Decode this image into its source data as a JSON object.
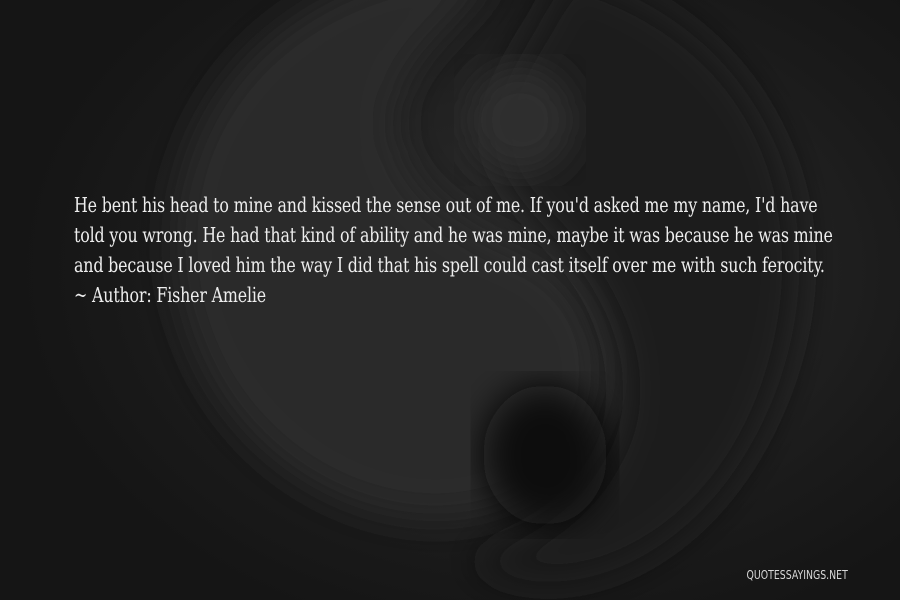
{
  "quote": {
    "text": "He bent his head to mine and kissed the sense out of me. If you'd asked me my name, I'd have told you wrong. He had that kind of ability and he was mine, maybe it was because he was mine and because I loved him the way I did that his spell could cast itself over me with such ferocity.",
    "author_prefix": "~ Author: ",
    "author": "Fisher Amelie"
  },
  "watermark": {
    "text": "QUOTESSAYINGS.NET"
  },
  "colors": {
    "background": "#1c1c1c",
    "text": "#ededed"
  }
}
